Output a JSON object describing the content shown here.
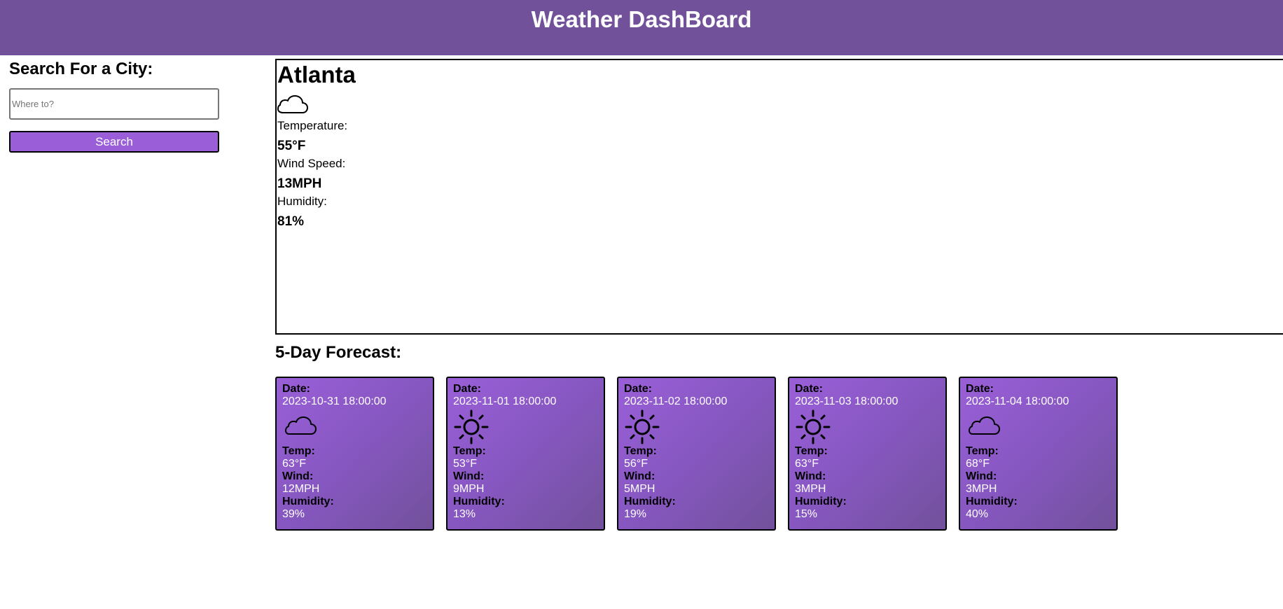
{
  "header": {
    "title": "Weather DashBoard"
  },
  "sidebar": {
    "heading": "Search For a City:",
    "search_placeholder": "Where to?",
    "search_button_label": "Search"
  },
  "current": {
    "city": "Atlanta",
    "icon": "cloud-icon",
    "temperature_label": "Temperature:",
    "temperature_value": "55°F",
    "wind_label": "Wind Speed:",
    "wind_value": "13MPH",
    "humidity_label": "Humidity:",
    "humidity_value": "81%"
  },
  "forecast": {
    "title": "5-Day Forecast:",
    "labels": {
      "date": "Date:",
      "temp": "Temp:",
      "wind": "Wind:",
      "humidity": "Humidity:"
    },
    "days": [
      {
        "date": "2023-10-31 18:00:00",
        "icon": "cloud-icon",
        "temp": "63°F",
        "wind": "12MPH",
        "humidity": "39%"
      },
      {
        "date": "2023-11-01 18:00:00",
        "icon": "sun-icon",
        "temp": "53°F",
        "wind": "9MPH",
        "humidity": "13%"
      },
      {
        "date": "2023-11-02 18:00:00",
        "icon": "sun-icon",
        "temp": "56°F",
        "wind": "5MPH",
        "humidity": "19%"
      },
      {
        "date": "2023-11-03 18:00:00",
        "icon": "sun-icon",
        "temp": "63°F",
        "wind": "3MPH",
        "humidity": "15%"
      },
      {
        "date": "2023-11-04 18:00:00",
        "icon": "cloud-icon",
        "temp": "68°F",
        "wind": "3MPH",
        "humidity": "40%"
      }
    ]
  },
  "colors": {
    "header": "#72519b",
    "accent": "#9a5fd8",
    "card_gradient_end": "#72519b"
  }
}
